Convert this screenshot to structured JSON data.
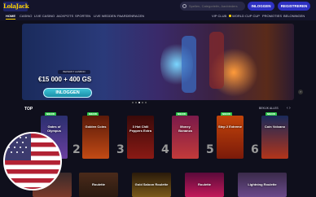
{
  "header": {
    "logo_text": "LolaJack",
    "search_placeholder": "Spellen, Categorieën, Aanbieders",
    "login_label": "INLOGGEN",
    "register_label": "REGISTREREN"
  },
  "nav": {
    "items": [
      "HOME",
      "CASINO",
      "LIVE CASINO",
      "JACKPOTS",
      "SPORTEN",
      "LIVE WEDDEN",
      "PAARDENRACEN"
    ],
    "right_items": [
      "VIP CLUB",
      "WORLD CUP CUP",
      "PROMOTIES",
      "BELONINGEN"
    ]
  },
  "banner": {
    "small_text": "BEPERKT AANBOD",
    "promo_text": "€15 000 + 400 GS",
    "cta_label": "INLOGGEN"
  },
  "top_section": {
    "title": "TOP",
    "see_all_label": "BEKIJK ALLES"
  },
  "games": [
    {
      "rank": "1",
      "name": "Gates of Olympus",
      "badge": "NIEUW"
    },
    {
      "rank": "2",
      "name": "Golden Coins",
      "badge": "NIEUW"
    },
    {
      "rank": "3",
      "name": "3 Hot Chili Peppers Extra",
      "badge": ""
    },
    {
      "rank": "4",
      "name": "Money Bonanza",
      "badge": "NIEUW"
    },
    {
      "rank": "5",
      "name": "Step 2 Extreme",
      "badge": "NIEUW"
    },
    {
      "rank": "6",
      "name": "Coin Volcano",
      "badge": "NIEUW"
    }
  ],
  "row2": [
    "",
    "Roulette",
    "Gold Saloon Roulette",
    "Roulette",
    "Lightning Roulette"
  ],
  "colors": {
    "accent": "#2e31c2",
    "badge_green": "#2ec54a",
    "gold": "#ffd400"
  }
}
